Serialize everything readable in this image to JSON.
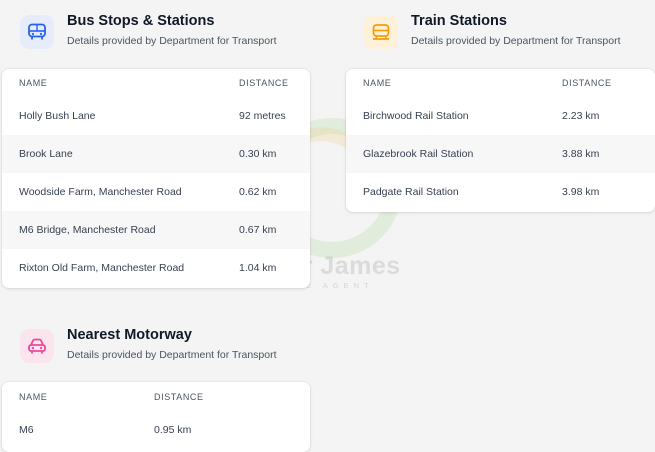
{
  "bus": {
    "title": "Bus Stops & Stations",
    "subtitle": "Details provided by Department for Transport",
    "icon": "bus-icon",
    "accent": "#2563eb",
    "icon_bg": "#e6ecfb",
    "col_name": "NAME",
    "col_distance": "DISTANCE",
    "rows": [
      {
        "name": "Holly Bush Lane",
        "distance": "92 metres"
      },
      {
        "name": "Brook Lane",
        "distance": "0.30 km"
      },
      {
        "name": "Woodside Farm, Manchester Road",
        "distance": "0.62 km"
      },
      {
        "name": "M6 Bridge, Manchester Road",
        "distance": "0.67 km"
      },
      {
        "name": "Rixton Old Farm, Manchester Road",
        "distance": "1.04 km"
      }
    ]
  },
  "train": {
    "title": "Train Stations",
    "subtitle": "Details provided by Department for Transport",
    "icon": "train-icon",
    "accent": "#f59e0b",
    "icon_bg": "#fdf1d9",
    "col_name": "NAME",
    "col_distance": "DISTANCE",
    "rows": [
      {
        "name": "Birchwood Rail Station",
        "distance": "2.23 km"
      },
      {
        "name": "Glazebrook Rail Station",
        "distance": "3.88 km"
      },
      {
        "name": "Padgate Rail Station",
        "distance": "3.98 km"
      }
    ]
  },
  "motorway": {
    "title": "Nearest Motorway",
    "subtitle": "Details provided by Department for Transport",
    "icon": "car-icon",
    "accent": "#ec4899",
    "icon_bg": "#fce4ef",
    "col_name": "NAME",
    "col_distance": "DISTANCE",
    "rows": [
      {
        "name": "M6",
        "distance": "0.95 km"
      }
    ]
  },
  "watermark": {
    "name": "Oliver James",
    "tagline": "ESTATE AGENT"
  }
}
